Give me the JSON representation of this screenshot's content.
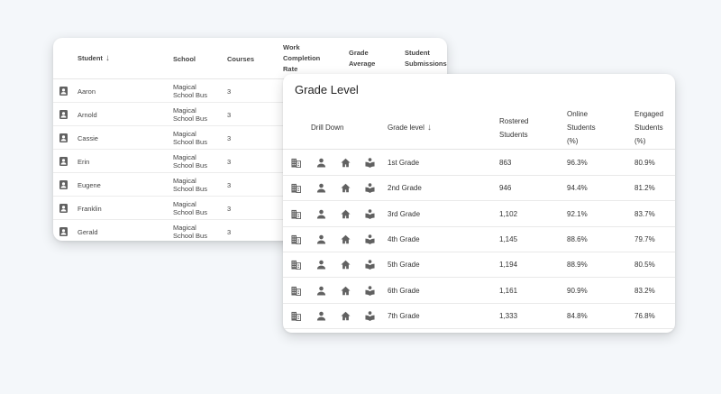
{
  "students_table": {
    "headers": {
      "student": "Student",
      "school": "School",
      "courses": "Courses",
      "work_completion": [
        "Work",
        "Completion",
        "Rate"
      ],
      "grade_average": [
        "Grade",
        "Average"
      ],
      "student_submissions": [
        "Student",
        "Submissions"
      ]
    },
    "sort_icon": "arrow-down-icon",
    "rows": [
      {
        "name": "Aaron",
        "school": [
          "Magical",
          "School Bus"
        ],
        "courses": "3"
      },
      {
        "name": "Arnold",
        "school": [
          "Magical",
          "School Bus"
        ],
        "courses": "3"
      },
      {
        "name": "Cassie",
        "school": [
          "Magical",
          "School Bus"
        ],
        "courses": "3"
      },
      {
        "name": "Erin",
        "school": [
          "Magical",
          "School Bus"
        ],
        "courses": "3"
      },
      {
        "name": "Eugene",
        "school": [
          "Magical",
          "School Bus"
        ],
        "courses": "3"
      },
      {
        "name": "Franklin",
        "school": [
          "Magical",
          "School Bus"
        ],
        "courses": "3"
      },
      {
        "name": "Gerald",
        "school": [
          "Magical",
          "School Bus"
        ],
        "courses": "3"
      }
    ]
  },
  "grade_table": {
    "title": "Grade Level",
    "headers": {
      "drill_down": "Drill Down",
      "grade_level": "Grade level",
      "rostered": [
        "Rostered",
        "Students"
      ],
      "online": [
        "Online",
        "Students",
        "(%)"
      ],
      "engaged": [
        "Engaged",
        "Students",
        "(%)"
      ]
    },
    "drill_icons": [
      "building-icon",
      "person-icon",
      "home-icon",
      "reading-icon"
    ],
    "rows": [
      {
        "grade": "1st Grade",
        "rostered": "863",
        "online": "96.3%",
        "engaged": "80.9%"
      },
      {
        "grade": "2nd Grade",
        "rostered": "946",
        "online": "94.4%",
        "engaged": "81.2%"
      },
      {
        "grade": "3rd Grade",
        "rostered": "1,102",
        "online": "92.1%",
        "engaged": "83.7%"
      },
      {
        "grade": "4th Grade",
        "rostered": "1,145",
        "online": "88.6%",
        "engaged": "79.7%"
      },
      {
        "grade": "5th Grade",
        "rostered": "1,194",
        "online": "88.9%",
        "engaged": "80.5%"
      },
      {
        "grade": "6th Grade",
        "rostered": "1,161",
        "online": "90.9%",
        "engaged": "83.2%"
      },
      {
        "grade": "7th Grade",
        "rostered": "1,333",
        "online": "84.8%",
        "engaged": "76.8%"
      }
    ]
  },
  "colors": {
    "background": "#f4f7fa",
    "icon": "#616161",
    "text": "#333333"
  }
}
